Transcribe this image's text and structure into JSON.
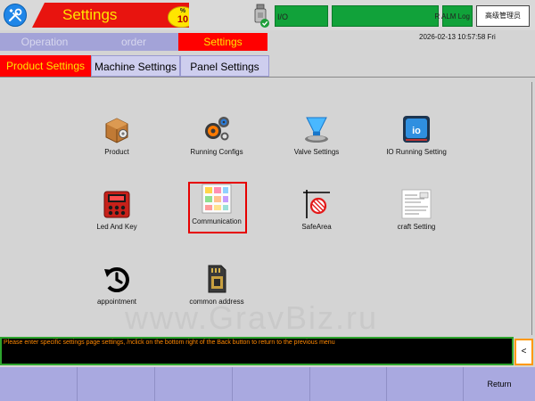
{
  "header": {
    "title": "Settings",
    "clock_badge": {
      "percent": "%",
      "value": "10"
    },
    "io_label": "I/O",
    "alm_label": "R ALM Log",
    "user_button": "高级管理员"
  },
  "main_tabs": {
    "operation": "Operation",
    "order": "order",
    "settings": "Settings"
  },
  "datetime": "2026-02-13  10:57:58  Fri",
  "sub_tabs": {
    "product": "Product Settings",
    "machine": "Machine Settings",
    "panel": "Panel Settings"
  },
  "tiles": {
    "product": "Product",
    "running_configs": "Running Configs",
    "valve": "Valve Settings",
    "io_running": "IO Running Setting",
    "led_key": "Led And Key",
    "communication": "Communication",
    "safe_area": "SafeArea",
    "craft": "craft Setting",
    "appointment": "appointment",
    "common_address": "common address"
  },
  "watermark": "www.GravBiz.ru",
  "message": "Please enter specific settings page settings, /nclick on the bottom right of the Back button to return to the previous menu",
  "back_button": "<",
  "footer": {
    "return": "Return"
  },
  "colors": {
    "accent_red": "#ff0000",
    "title_yellow": "#ffe400",
    "status_green": "#11a23a",
    "tab_lavender": "#a3a3d8",
    "message_orange": "#ff8800"
  }
}
